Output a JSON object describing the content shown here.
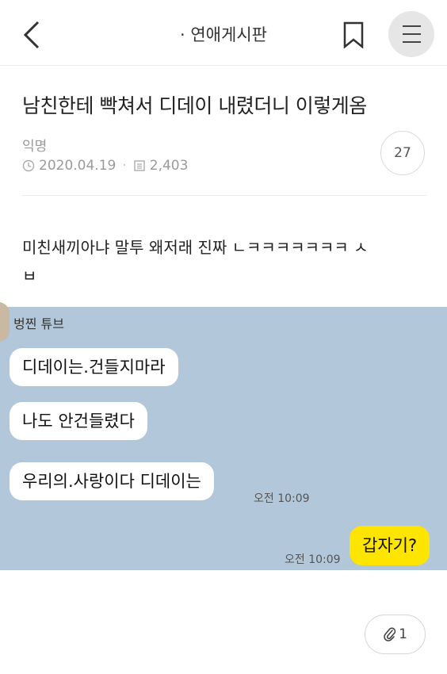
{
  "header": {
    "back_icon": "chevron-left-icon",
    "board_name": "· 연애게시판",
    "bookmark_icon": "bookmark-icon",
    "menu_icon": "hamburger-menu-icon"
  },
  "post": {
    "title": "남친한테 빡쳐서 디데이 내렸더니 이렇게옴",
    "author": "익명",
    "date": "2020.04.19",
    "views": "2,403",
    "comment_count": "27",
    "body_line1": "미친새끼아냐 말투 왜저래 진짜 ㄴㅋㅋㅋㅋㅋㅋㅋ ㅅ",
    "body_line2": "ㅂ"
  },
  "chat": {
    "background_color": "#b2c7d9",
    "sender_name": "벙찐 튜브",
    "messages": [
      {
        "text": "디데이는.건들지마라",
        "from": "other"
      },
      {
        "text": "나도 안건들렸다",
        "from": "other"
      },
      {
        "text": "우리의.사랑이다 디데이는",
        "from": "other",
        "time": "오전 10:09"
      },
      {
        "text": "갑자기?",
        "from": "me",
        "time": "오전 10:09"
      }
    ]
  },
  "footer": {
    "attachment_icon": "paperclip-icon",
    "attachment_count": "1"
  }
}
